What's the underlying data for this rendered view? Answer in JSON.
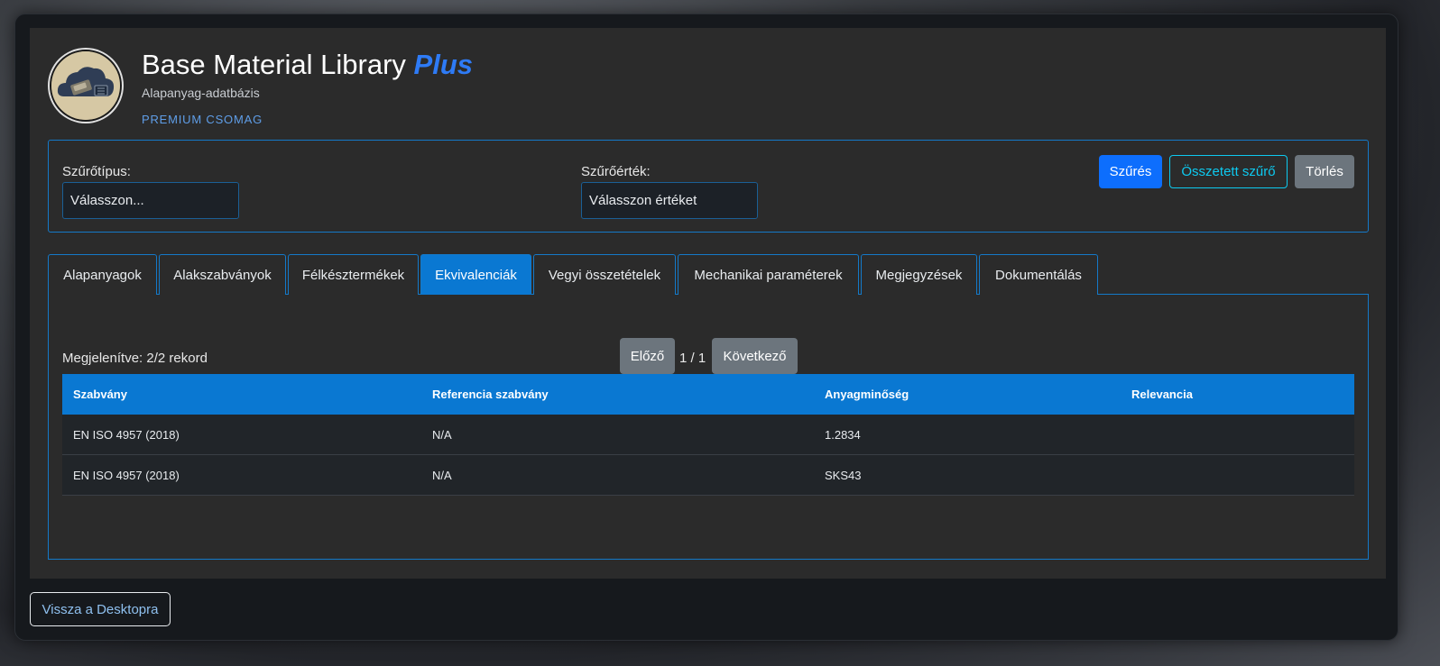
{
  "header": {
    "title": "Base Material Library",
    "title_accent": "Plus",
    "subtitle": "Alapanyag-adatbázis",
    "badge": "PREMIUM CSOMAG",
    "logo_icon": "cloud-database-logo"
  },
  "filter": {
    "type_label": "Szűrőtípus:",
    "type_value": "Válasszon...",
    "value_label": "Szűrőérték:",
    "value_value": "Válasszon értéket",
    "filter_button": "Szűrés",
    "compound_button": "Összetett szűrő",
    "clear_button": "Törlés"
  },
  "tabs": [
    {
      "label": "Alapanyagok",
      "active": false
    },
    {
      "label": "Alakszabványok",
      "active": false
    },
    {
      "label": "Félkésztermékek",
      "active": false
    },
    {
      "label": "Ekvivalenciák",
      "active": true
    },
    {
      "label": "Vegyi összetételek",
      "active": false
    },
    {
      "label": "Mechanikai paraméterek",
      "active": false
    },
    {
      "label": "Megjegyzések",
      "active": false
    },
    {
      "label": "Dokumentálás",
      "active": false
    }
  ],
  "content": {
    "records_text": "Megjelenítve: 2/2 rekord",
    "prev_button": "Előző",
    "page_indicator": "1 / 1",
    "next_button": "Következő",
    "columns": [
      "Szabvány",
      "Referencia szabvány",
      "Anyagminőség",
      "Relevancia"
    ],
    "rows": [
      [
        "EN ISO 4957 (2018)",
        "N/A",
        "1.2834",
        ""
      ],
      [
        "EN ISO 4957 (2018)",
        "N/A",
        "SKS43",
        ""
      ]
    ]
  },
  "footer": {
    "back_button": "Vissza a Desktopra"
  },
  "colors": {
    "accent": "#0a78d2",
    "primary": "#0d6efd",
    "info": "#0dcaf0",
    "secondary": "#6c757d"
  }
}
